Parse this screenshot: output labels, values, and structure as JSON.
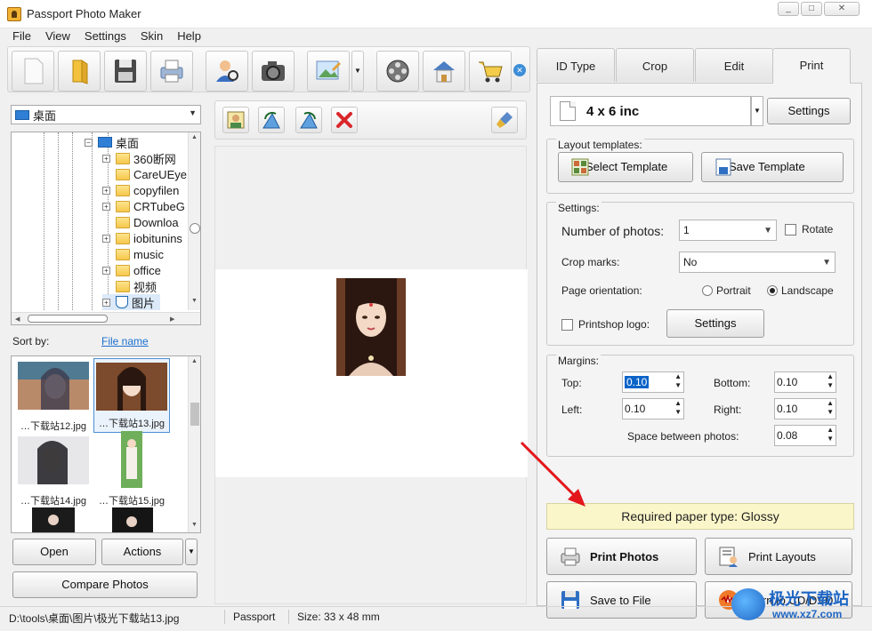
{
  "window": {
    "title": "Passport Photo Maker",
    "controls": [
      "_",
      "□",
      "✕"
    ]
  },
  "menu": [
    "File",
    "View",
    "Settings",
    "Skin",
    "Help"
  ],
  "toolbar": {
    "buttons": [
      "new-icon",
      "open-icon",
      "save-icon",
      "print-icon",
      "person-search-icon",
      "camera-icon",
      "image-edit-icon",
      "film-icon",
      "home-icon",
      "cart-icon"
    ]
  },
  "folder": {
    "selected": "桌面"
  },
  "tree": {
    "root": "桌面",
    "items": [
      "360断网",
      "CareUEye",
      "copyfilen",
      "CRTubeG",
      "Downloa",
      "iobitunins",
      "music",
      "office",
      "视频",
      "图片"
    ]
  },
  "sort": {
    "label": "Sort by:",
    "value": "File name"
  },
  "thumbnails": [
    {
      "caption": "…下载站12.jpg"
    },
    {
      "caption": "…下载站13.jpg"
    },
    {
      "caption": "…下载站14.jpg"
    },
    {
      "caption": "…下载站15.jpg"
    }
  ],
  "left_buttons": {
    "open": "Open",
    "actions": "Actions",
    "compare": "Compare Photos"
  },
  "tabs": [
    "ID Type",
    "Crop",
    "Edit",
    "Print"
  ],
  "print": {
    "paper_size": "4 x 6 inc",
    "settings_button": "Settings",
    "layout_group": "Layout templates:",
    "select_template": "Select Template",
    "save_template": "Save Template",
    "settings_group": "Settings:",
    "num_photos_label": "Number of photos:",
    "num_photos_value": "1",
    "rotate_label": "Rotate",
    "crop_marks_label": "Crop marks:",
    "crop_marks_value": "No",
    "orientation_label": "Page orientation:",
    "portrait_label": "Portrait",
    "landscape_label": "Landscape",
    "orientation_value": "Landscape",
    "printshop_label": "Printshop logo:",
    "printshop_settings": "Settings",
    "margins_group": "Margins:",
    "top_label": "Top:",
    "top_value": "0.10",
    "bottom_label": "Bottom:",
    "bottom_value": "0.10",
    "left_label": "Left:",
    "left_value": "0.10",
    "right_label": "Right:",
    "right_value": "0.10",
    "space_label": "Space between photos:",
    "space_value": "0.08",
    "required_paper": "Required paper type: Glossy",
    "print_photos": "Print Photos",
    "print_layouts": "Print Layouts",
    "save_to_file": "Save to File",
    "burn": "Burn to CD/DVD"
  },
  "status": {
    "path": "D:\\tools\\桌面\\图片\\极光下载站13.jpg",
    "type": "Passport",
    "size": "Size: 33 x 48 mm"
  },
  "watermark": {
    "big": "极光下载站",
    "small": "www.xz7.com"
  }
}
